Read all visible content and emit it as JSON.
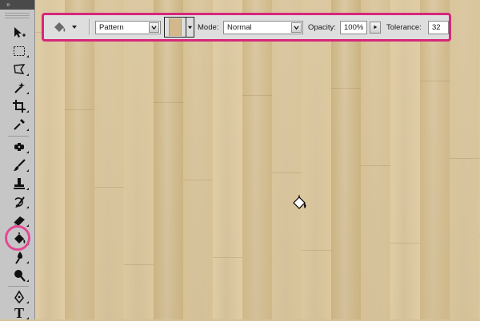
{
  "toolbox": {
    "collapse_glyph": "»",
    "tools": [
      {
        "name": "move-tool",
        "icon": "move-icon"
      },
      {
        "name": "marquee-tool",
        "icon": "rectangular-marquee-icon"
      },
      {
        "name": "lasso-tool",
        "icon": "polygonal-lasso-icon"
      },
      {
        "name": "magic-wand-tool",
        "icon": "magic-wand-icon"
      },
      {
        "name": "crop-tool",
        "icon": "crop-icon"
      },
      {
        "name": "eyedropper-tool",
        "icon": "eyedropper-icon"
      },
      {
        "name": "healing-tool",
        "icon": "spot-healing-icon"
      },
      {
        "name": "brush-tool",
        "icon": "brush-icon"
      },
      {
        "name": "clone-stamp-tool",
        "icon": "clone-stamp-icon"
      },
      {
        "name": "history-brush-tool",
        "icon": "history-brush-icon"
      },
      {
        "name": "eraser-tool",
        "icon": "eraser-icon"
      },
      {
        "name": "paint-bucket-tool",
        "icon": "paint-bucket-icon",
        "active": true
      },
      {
        "name": "blur-tool",
        "icon": "blur-icon"
      },
      {
        "name": "dodge-tool",
        "icon": "dodge-icon"
      },
      {
        "name": "pen-tool",
        "icon": "pen-icon"
      },
      {
        "name": "type-tool",
        "icon": "type-icon"
      }
    ],
    "type_tool_glyph": "T"
  },
  "options_bar": {
    "tool_preset_icon": "paint-bucket-icon",
    "fill_source": "Pattern",
    "pattern_swatch_color": "#d2b88a",
    "mode_label": "Mode:",
    "mode_value": "Normal",
    "opacity_label": "Opacity:",
    "opacity_value": "100%",
    "tolerance_label": "Tolerance:",
    "tolerance_value": "32"
  },
  "colors": {
    "highlight": "#d8267b",
    "wood_light": "#dcc89e",
    "wood_dark": "#cbb382"
  },
  "canvas": {
    "cursor_icon": "paint-bucket-cursor-icon"
  }
}
